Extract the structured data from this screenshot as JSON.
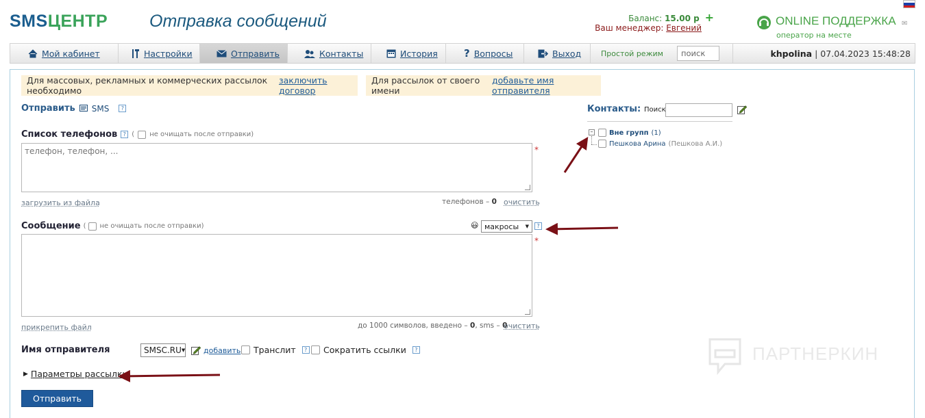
{
  "header": {
    "logo_part1": "SMS",
    "logo_part2": "ЦЕНТР",
    "page_title": "Отправка сообщений",
    "balance_label": "Баланс:",
    "balance_value": "15.00 р",
    "balance_add": "+",
    "manager_label": "Ваш менеджер:",
    "manager_name": "Евгений",
    "support_title": "ONLINE ПОДДЕРЖКА",
    "support_status": "оператор на месте",
    "colors": {
      "logo_blue": "#1b5e8f",
      "logo_green": "#3aa35a",
      "support_green": "#49a449"
    }
  },
  "nav": {
    "items": [
      {
        "label": "Мой кабинет",
        "icon": "home-icon"
      },
      {
        "label": "Настройки",
        "icon": "tools-icon"
      },
      {
        "label": "Отправить",
        "icon": "envelope-icon",
        "active": true
      },
      {
        "label": "Контакты",
        "icon": "contacts-icon"
      },
      {
        "label": "История",
        "icon": "calendar-icon"
      },
      {
        "label": "Вопросы",
        "icon": "question-icon"
      },
      {
        "label": "Выход",
        "icon": "exit-icon"
      }
    ],
    "simple_mode": "Простой режим",
    "search_placeholder": "поиск",
    "username": "khpolina",
    "datetime": "| 07.04.2023 15:48:28"
  },
  "notices": {
    "contract_text": "Для массовых, рекламных и коммерческих рассылок необходимо",
    "contract_link": "заключить договор",
    "sender_text": "Для рассылок от своего имени",
    "sender_link": "добавьте имя отправителя"
  },
  "send": {
    "label": "Отправить",
    "type": "SMS",
    "help": "?"
  },
  "phones": {
    "label": "Список телефонов",
    "no_clear_paren_open": "(",
    "no_clear": "не очищать после отправки)",
    "placeholder": "телефон, телефон, ...",
    "required": "*",
    "upload_link": "загрузить из файла",
    "count_label": "телефонов –",
    "count_value": "0",
    "clear_link": "очистить"
  },
  "message": {
    "label": "Сообщение",
    "no_clear": "не очищать после отправки)",
    "paren_open": "(",
    "emoji": "😃",
    "macros_value": "макросы",
    "required": "*",
    "attach_link": "прикрепить файл",
    "limit_text": "до 1000 символов, введено –",
    "entered": "0",
    "sms_text": ", sms –",
    "sms_count": "0",
    "clear_link": "очистить"
  },
  "sender": {
    "label": "Имя отправителя",
    "value": "SMSC.RU",
    "add_link": "добавить",
    "translit": "Транслит",
    "shorten_links": "Сократить ссылки"
  },
  "params_toggle": "Параметры рассылки",
  "send_button": "Отправить",
  "contacts": {
    "title": "Контакты:",
    "search_label": "Поиск",
    "group_name": "Вне групп",
    "group_count": "(1)",
    "contact_name": "Пешкова Арина",
    "contact_short": "(Пешкова А.И.)"
  },
  "watermark": "ПАРТНЕРКИН",
  "annotation_arrow_color": "#7a1016"
}
